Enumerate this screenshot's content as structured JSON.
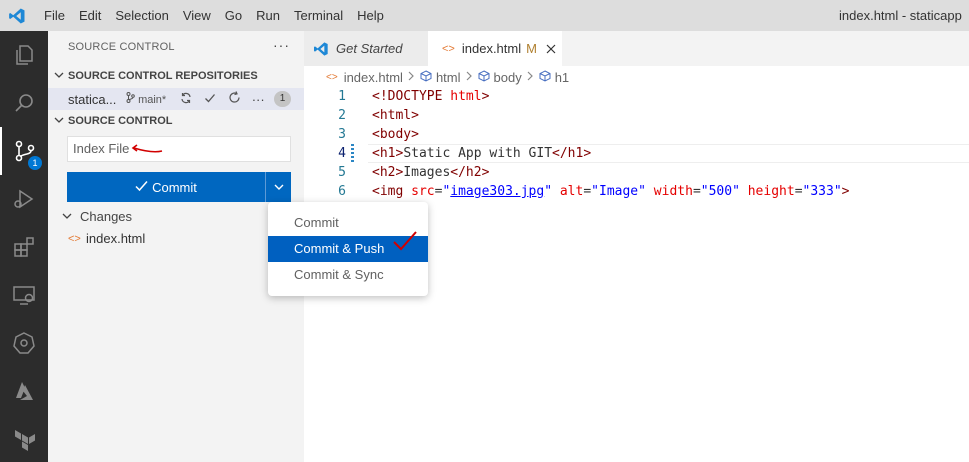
{
  "titlebar": {
    "menu": [
      "File",
      "Edit",
      "Selection",
      "View",
      "Go",
      "Run",
      "Terminal",
      "Help"
    ],
    "window_title": "index.html - staticapp"
  },
  "activity_bar": {
    "items": [
      "explorer-icon",
      "search-icon",
      "source-control-icon",
      "run-debug-icon",
      "extensions-icon",
      "remote-explorer-icon",
      "kubernetes-icon",
      "azure-icon",
      "terraform-icon"
    ],
    "source_control_badge": "1"
  },
  "sidebar": {
    "title": "SOURCE CONTROL",
    "repos_header": "SOURCE CONTROL REPOSITORIES",
    "repo": {
      "name": "statica...",
      "branch": "main*",
      "count": "1"
    },
    "sc_header": "SOURCE CONTROL",
    "message_value": "Index File",
    "commit_label": "Commit",
    "changes_label": "Changes",
    "changed_file": "index.html"
  },
  "dropdown": {
    "items": [
      "Commit",
      "Commit & Push",
      "Commit & Sync"
    ],
    "selected": "Commit & Push"
  },
  "tabs": {
    "get_started": "Get Started",
    "active_file": "index.html",
    "modified_flag": "M"
  },
  "breadcrumb": [
    "index.html",
    "html",
    "body",
    "h1"
  ],
  "editor": {
    "line_numbers": [
      "1",
      "2",
      "3",
      "4",
      "5",
      "6"
    ],
    "lines": {
      "l1_tag": "<!DOCTYPE",
      "l1_word": "html",
      "l1_end": ">",
      "l2": "<html>",
      "l3": "<body>",
      "l4_open": "<h1>",
      "l4_text": "Static App with GIT",
      "l4_close": "</h1>",
      "l5_open": "<h2>",
      "l5_text": "Images",
      "l5_close": "</h2>",
      "l6_open": "<img",
      "l6_src_attr": "src",
      "l6_src_val": "image303.jpg",
      "l6_alt_attr": "alt",
      "l6_alt_val": "\"Image\"",
      "l6_width_attr": "width",
      "l6_width_val": "\"500\"",
      "l6_height_attr": "height",
      "l6_height_val": "\"333\"",
      "l6_end": ">"
    }
  },
  "colors": {
    "accent": "#0067c0",
    "selected_menu": "#0060c0",
    "activity_bar": "#2c2c2c",
    "annotation_red": "#d10000"
  }
}
